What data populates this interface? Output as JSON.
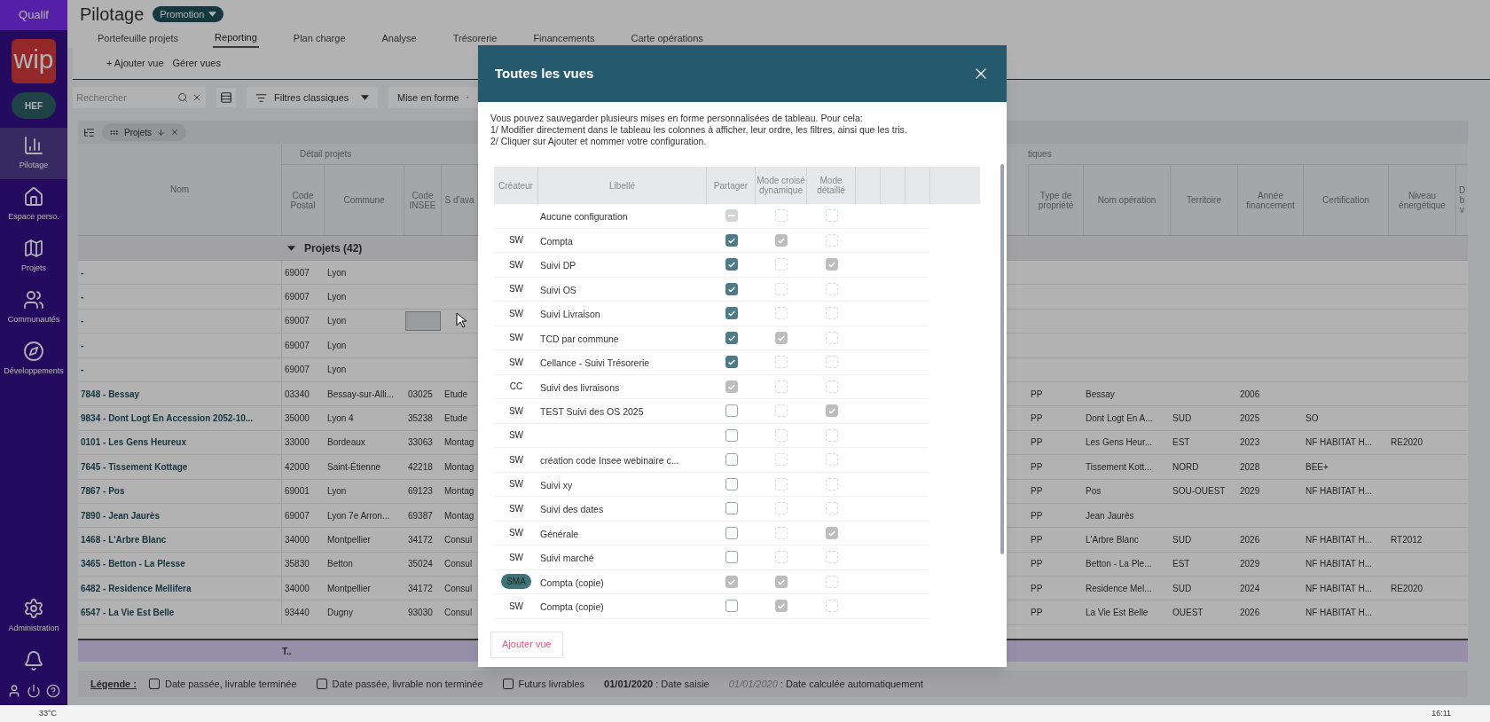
{
  "sidebar": {
    "env": "Qualif",
    "logo": "wip",
    "org": "HEF",
    "items": [
      {
        "label": "Pilotage",
        "selected": true
      },
      {
        "label": "Espace perso.",
        "selected": false
      },
      {
        "label": "Projets",
        "selected": false
      },
      {
        "label": "Communautés",
        "selected": false
      },
      {
        "label": "Développements",
        "selected": false
      }
    ],
    "admin": "Administration"
  },
  "header": {
    "title": "Pilotage",
    "badge": "Promotion"
  },
  "tabs": [
    {
      "label": "Portefeuille projets",
      "selected": false
    },
    {
      "label": "Reporting",
      "selected": true
    },
    {
      "label": "Plan charge",
      "selected": false
    },
    {
      "label": "Analyse",
      "selected": false
    },
    {
      "label": "Trésorerie",
      "selected": false
    },
    {
      "label": "Financements",
      "selected": false
    },
    {
      "label": "Carte opérations",
      "selected": false
    }
  ],
  "views": {
    "add": "+ Ajouter vue",
    "manage": "Gérer vues"
  },
  "toolbar": {
    "search": {
      "placeholder": "Rechercher"
    },
    "filters": "Filtres classiques",
    "format": "Mise en forme"
  },
  "group_chip": "Projets",
  "table": {
    "group_left": "Détail projets",
    "group_right": "tiques",
    "columns_left": [
      "Nom",
      "Code Postal",
      "Commune",
      "Code INSEE",
      "S d'ava"
    ],
    "columns_right": [
      "Type de propriété",
      "Nom opération",
      "Territoire",
      "Année financement",
      "Certification",
      "Niveau énergétique",
      "D b v"
    ],
    "group_row": "Projets (42)",
    "rows": [
      {
        "cells": [
          "-",
          "69007",
          "Lyon",
          null,
          null,
          null,
          null,
          null,
          null,
          null,
          null
        ],
        "focused": false
      },
      {
        "cells": [
          "-",
          "69007",
          "Lyon",
          null,
          null,
          null,
          null,
          null,
          null,
          null,
          null
        ],
        "focused": false
      },
      {
        "cells": [
          "-",
          "69007",
          "Lyon",
          null,
          null,
          null,
          null,
          null,
          null,
          null,
          null
        ],
        "focused": true
      },
      {
        "cells": [
          "-",
          "69007",
          "Lyon",
          null,
          null,
          null,
          null,
          null,
          null,
          null,
          null
        ],
        "focused": false
      },
      {
        "cells": [
          "-",
          "69007",
          "Lyon",
          null,
          null,
          null,
          null,
          null,
          null,
          null,
          null
        ],
        "focused": false
      },
      {
        "cells": [
          "7848 - Bessay",
          "03340",
          "Bessay-sur-Alli...",
          "03025",
          "Etude",
          "PP",
          "Bessay",
          null,
          "2006",
          null,
          null
        ],
        "focused": false
      },
      {
        "cells": [
          "9834 - Dont Logt En Accession 2052-10...",
          "35000",
          "Lyon 4",
          "35238",
          "Etude",
          "PP",
          "Dont Logt En A...",
          "SUD",
          "2025",
          "SO",
          null
        ],
        "focused": false
      },
      {
        "cells": [
          "0101 - Les Gens Heureux",
          "33000",
          "Bordeaux",
          "33063",
          "Montag",
          "PP",
          "Les Gens Heur...",
          "EST",
          "2023",
          "NF HABITAT H...",
          "RE2020"
        ],
        "focused": false
      },
      {
        "cells": [
          "7645 - Tissement Kottage",
          "42000",
          "Saint-Étienne",
          "42218",
          "Montag",
          "PP",
          "Tissement Kott...",
          "NORD",
          "2028",
          "BEE+",
          null
        ],
        "focused": false
      },
      {
        "cells": [
          "7867 - Pos",
          "69001",
          "Lyon",
          "69123",
          "Montag",
          "PP",
          "Pos",
          "SOU-OUEST",
          "2029",
          "NF HABITAT H...",
          null
        ],
        "focused": false
      },
      {
        "cells": [
          "7890 - Jean Jaurès",
          "69007",
          "Lyon 7e Arron...",
          "69387",
          "Montag",
          "PP",
          "Jean Jaurès",
          null,
          null,
          null,
          null
        ],
        "focused": false
      },
      {
        "cells": [
          "1468 - L'Arbre Blanc",
          "34000",
          "Montpellier",
          "34172",
          "Consul",
          "PP",
          "L'Arbre Blanc",
          "SUD",
          "2026",
          "NF HABITAT H...",
          "RT2012"
        ],
        "focused": false
      },
      {
        "cells": [
          "3465 - Betton - La Plesse",
          "35830",
          "Betton",
          "35024",
          "Consul",
          "PP",
          "Betton - La Ple...",
          "EST",
          "2029",
          "NF HABITAT H...",
          null
        ],
        "focused": false
      },
      {
        "cells": [
          "6482 - Residence Mellifera",
          "34000",
          "Montpellier",
          "34172",
          "Consul",
          "PP",
          "Residence Mel...",
          "SUD",
          "2024",
          "NF HABITAT H...",
          "RE2020"
        ],
        "focused": false
      },
      {
        "cells": [
          "6547 - La Vie Est Belle",
          "93440",
          "Dugny",
          "93030",
          "Consul",
          "PP",
          "La Vie Est Belle",
          "OUEST",
          "2026",
          "NF HABITAT H...",
          null
        ],
        "focused": false
      }
    ],
    "footer": "T.."
  },
  "legend": {
    "title": "Légende :",
    "items": [
      {
        "kind": "box",
        "text": "Date passée, livrable terminée"
      },
      {
        "kind": "box",
        "text": "Date passée, livrable non terminée"
      },
      {
        "kind": "box",
        "text": "Futurs livrables"
      },
      {
        "kind": "entered",
        "date": "01/01/2020",
        "text": ": Date saisie"
      },
      {
        "kind": "computed",
        "date": "01/01/2020",
        "text": ": Date calculée automatiquement"
      }
    ]
  },
  "modal": {
    "title": "Toutes les vues",
    "intro": [
      "Vous pouvez sauvegarder plusieurs mises en forme personnalisées de tableau. Pour cela:",
      "1/ Modifier directement dans le tableau les colonnes à afficher, leur ordre, les filtres, ainsi que les tris.",
      "2/ Cliquer sur Ajouter et nommer votre configuration."
    ],
    "columns": [
      "Créateur",
      "Libellé",
      "Partager",
      "Mode croisé dynamique",
      "Mode détaillé"
    ],
    "rows": [
      {
        "label": "Aucune configuration",
        "share": {
          "mixed": true
        },
        "pivot": {
          "checked": false,
          "disabled": true
        },
        "detail": {
          "checked": false,
          "disabled": true
        }
      },
      {
        "creator": "SW",
        "label": "Compta",
        "badge": false,
        "share": {
          "checked": true,
          "disabled": false
        },
        "pivot": {
          "checked": true,
          "disabled": true
        },
        "detail": {
          "checked": false,
          "disabled": true
        }
      },
      {
        "creator": "SW",
        "label": "Suivi DP",
        "badge": false,
        "share": {
          "checked": true,
          "disabled": false
        },
        "pivot": {
          "checked": false,
          "disabled": true
        },
        "detail": {
          "checked": true,
          "disabled": true
        }
      },
      {
        "creator": "SW",
        "label": "Suivi OS",
        "badge": false,
        "share": {
          "checked": true,
          "disabled": false
        },
        "pivot": {
          "checked": false,
          "disabled": true
        },
        "detail": {
          "checked": false,
          "disabled": true
        }
      },
      {
        "creator": "SW",
        "label": "Suivi Livraison",
        "badge": false,
        "share": {
          "checked": true,
          "disabled": false
        },
        "pivot": {
          "checked": false,
          "disabled": true
        },
        "detail": {
          "checked": false,
          "disabled": true
        }
      },
      {
        "creator": "SW",
        "label": "TCD par commune",
        "badge": false,
        "share": {
          "checked": true,
          "disabled": false
        },
        "pivot": {
          "checked": true,
          "disabled": true
        },
        "detail": {
          "checked": false,
          "disabled": true
        }
      },
      {
        "creator": "SW",
        "label": "Cellance - Suivi Trésorerie",
        "badge": false,
        "share": {
          "checked": true,
          "disabled": false
        },
        "pivot": {
          "checked": false,
          "disabled": true
        },
        "detail": {
          "checked": false,
          "disabled": true
        }
      },
      {
        "creator": "CC",
        "label": "Suivi des livraisons",
        "badge": false,
        "share": {
          "checked": true,
          "disabled": true
        },
        "pivot": {
          "checked": false,
          "disabled": true
        },
        "detail": {
          "checked": false,
          "disabled": true
        }
      },
      {
        "creator": "SW",
        "label": "TEST Suivi des OS 2025",
        "badge": false,
        "share": {
          "checked": false,
          "disabled": false
        },
        "pivot": {
          "checked": false,
          "disabled": true
        },
        "detail": {
          "checked": true,
          "disabled": true
        }
      },
      {
        "creator": "SW",
        "badge": false,
        "share": {
          "checked": false,
          "disabled": false
        },
        "pivot": {
          "checked": false,
          "disabled": true
        },
        "detail": {
          "checked": false,
          "disabled": true
        }
      },
      {
        "creator": "SW",
        "label": "création code Insee webinaire c...",
        "badge": false,
        "share": {
          "checked": false,
          "disabled": false
        },
        "pivot": {
          "checked": false,
          "disabled": true
        },
        "detail": {
          "checked": false,
          "disabled": true
        }
      },
      {
        "creator": "SW",
        "label": "Suivi xy",
        "badge": false,
        "share": {
          "checked": false,
          "disabled": false
        },
        "pivot": {
          "checked": false,
          "disabled": true
        },
        "detail": {
          "checked": false,
          "disabled": true
        }
      },
      {
        "creator": "SW",
        "label": "Suivi des dates",
        "badge": false,
        "share": {
          "checked": false,
          "disabled": false
        },
        "pivot": {
          "checked": false,
          "disabled": true
        },
        "detail": {
          "checked": false,
          "disabled": true
        }
      },
      {
        "creator": "SW",
        "label": "Générale",
        "badge": false,
        "share": {
          "checked": false,
          "disabled": false
        },
        "pivot": {
          "checked": false,
          "disabled": true
        },
        "detail": {
          "checked": true,
          "disabled": true
        }
      },
      {
        "creator": "SW",
        "label": "Suivi marché",
        "badge": false,
        "share": {
          "checked": false,
          "disabled": false
        },
        "pivot": {
          "checked": false,
          "disabled": true
        },
        "detail": {
          "checked": false,
          "disabled": true
        }
      },
      {
        "creator": "SMA",
        "label": "Compta (copie)",
        "badge": true,
        "share": {
          "checked": true,
          "disabled": true
        },
        "pivot": {
          "checked": true,
          "disabled": true
        },
        "detail": {
          "checked": false,
          "disabled": true
        }
      },
      {
        "creator": "SW",
        "label": "Compta (copie)",
        "badge": false,
        "share": {
          "checked": false,
          "disabled": false
        },
        "pivot": {
          "checked": true,
          "disabled": true
        },
        "detail": {
          "checked": false,
          "disabled": true
        }
      }
    ],
    "add_button": "Ajouter vue"
  },
  "taskbar": {
    "weather": "33°C",
    "clock": "16:11"
  }
}
